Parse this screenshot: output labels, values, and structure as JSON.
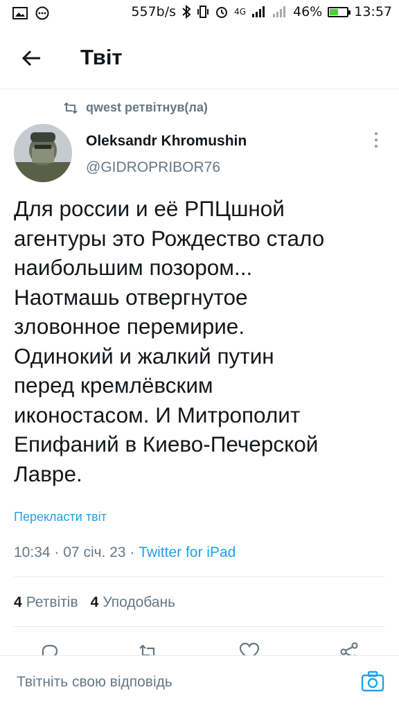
{
  "status_bar": {
    "net_speed": "557b/s",
    "network": "4G",
    "battery_percent": "46%",
    "battery_level": 0.46,
    "time": "13:57"
  },
  "header": {
    "title": "Твіт",
    "back_icon": "arrow-left-icon"
  },
  "retweet_context": {
    "text": "qwest ретвітнув(ла)",
    "icon": "retweet-icon"
  },
  "author": {
    "name": "Oleksandr Khromushin",
    "handle": "@GIDROPRIBOR76"
  },
  "tweet": {
    "text": "Для россии и её РПЦшной\nагентуры это Рождество стало\nнаибольшим позором...\nНаотмашь отвергнутое\nзловонное перемирие.\nОдинокий и жалкий путин\nперед кремлёвским\nиконостасом. И Митрополит\nЕпифаний в Киево-Печерской\nЛавре.",
    "translate_link": "Перекласти твіт",
    "time": "10:34",
    "date": "07 січ. 23",
    "separator": "·",
    "source": "Twitter for iPad"
  },
  "stats": {
    "retweets_count": "4",
    "retweets_label": "Ретвітів",
    "likes_count": "4",
    "likes_label": "Уподобань"
  },
  "actions": [
    "reply-icon",
    "retweet-icon",
    "like-icon",
    "share-icon"
  ],
  "reply_bar": {
    "placeholder": "Твітніть свою відповідь",
    "camera_icon": "camera-icon"
  },
  "colors": {
    "accent": "#1da1f2",
    "secondary_text": "#657786",
    "primary_text": "#14171a",
    "divider": "#e6ecf0"
  }
}
